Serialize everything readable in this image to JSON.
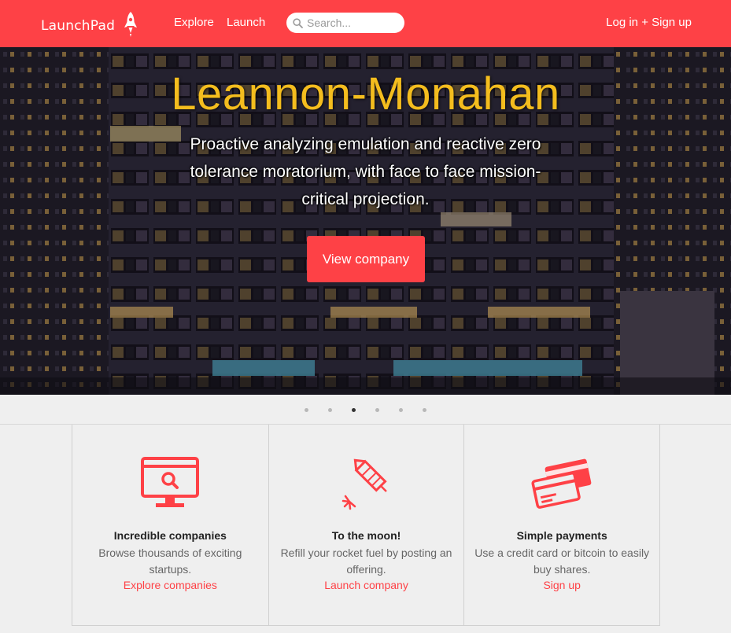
{
  "nav": {
    "brand": "LaunchPad",
    "links": [
      {
        "label": "Explore"
      },
      {
        "label": "Launch"
      }
    ],
    "search_placeholder": "Search...",
    "auth_label": "Log in + Sign up"
  },
  "hero": {
    "title": "Leannon-Monahan",
    "subtitle": "Proactive analyzing emulation and reactive zero tolerance moratorium, with face to face mission-critical projection.",
    "button_label": "View company"
  },
  "carousel": {
    "slide_count": 6,
    "active_index": 2
  },
  "features": [
    {
      "icon": "monitor-search-icon",
      "title": "Incredible companies",
      "desc": "Browse thousands of exciting startups.",
      "link": "Explore companies"
    },
    {
      "icon": "firework-rocket-icon",
      "title": "To the moon!",
      "desc": "Refill your rocket fuel by posting an offering.",
      "link": "Launch company"
    },
    {
      "icon": "credit-cards-icon",
      "title": "Simple payments",
      "desc": "Use a credit card or bitcoin to easily buy shares.",
      "link": "Sign up"
    }
  ],
  "colors": {
    "brand": "#fe4146",
    "hero_title": "#f4bd1e",
    "background": "#efefef"
  }
}
